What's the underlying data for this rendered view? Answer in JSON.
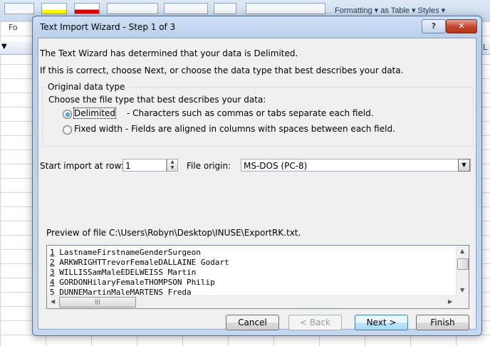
{
  "background": {
    "ribbon_formatting": "Formatting",
    "ribbon_as_table": "as Table",
    "ribbon_styles": "Styles",
    "fo_text": "Fo",
    "col_l": "L"
  },
  "dialog": {
    "title": "Text Import Wizard - Step 1 of 3",
    "help_label": "?",
    "close_label": "✕",
    "intro_line1": "The Text Wizard has determined that your data is Delimited.",
    "intro_line2": "If this is correct, choose Next, or choose the data type that best describes your data.",
    "group_label": "Original data type",
    "choose_label": "Choose the file type that best describes your data:",
    "delimited_label": "Delimited",
    "delimited_desc": "- Characters such as commas or tabs separate each field.",
    "fixed_label": "Fixed width",
    "fixed_desc": "- Fields are aligned in columns with spaces between each field.",
    "start_row_label": "Start import at row:",
    "start_row_value": "1",
    "file_origin_label": "File origin:",
    "file_origin_value": "MS-DOS (PC-8)",
    "preview_label": "Preview of file C:\\Users\\Robyn\\Desktop\\INUSE\\ExportRK.txt.",
    "preview_rows": [
      {
        "num": "1",
        "text": "LastnameFirstnameGenderSurgeon"
      },
      {
        "num": "2",
        "text": "ARKWRIGHTTrevorFemaleDALLAINE Godart"
      },
      {
        "num": "3",
        "text": "WILLISSamMaleEDELWEISS Martin"
      },
      {
        "num": "4",
        "text": "GORDONHilaryFemaleTHOMPSON Philip"
      },
      {
        "num": "5",
        "text": "DUNNEMartinMaleMARTENS Freda"
      }
    ],
    "buttons": {
      "cancel": "Cancel",
      "back": "< Back",
      "next": "Next >",
      "finish": "Finish"
    }
  }
}
